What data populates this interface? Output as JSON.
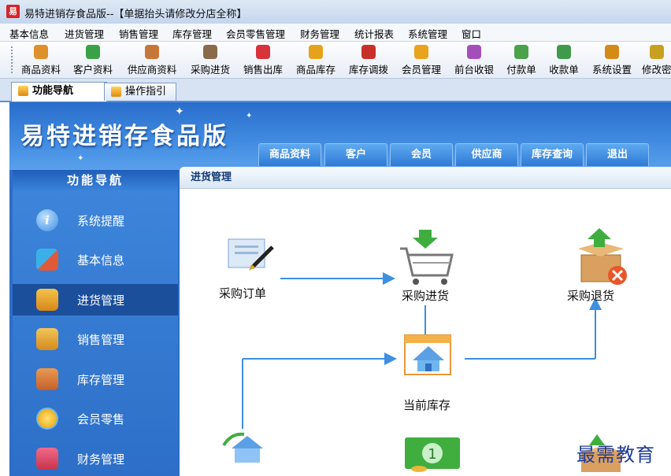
{
  "window": {
    "title": "易特进销存食品版--【单据抬头请修改分店全称】",
    "app_icon_text": "易"
  },
  "menu": [
    "基本信息",
    "进货管理",
    "销售管理",
    "库存管理",
    "会员零售管理",
    "财务管理",
    "统计报表",
    "系统管理",
    "窗口"
  ],
  "toolbar": [
    {
      "label": "商品资料",
      "icon": "goods-icon",
      "color": "#e0902a"
    },
    {
      "label": "客户资料",
      "icon": "customer-icon",
      "color": "#3aa246"
    },
    {
      "label": "供应商资料",
      "icon": "supplier-icon",
      "color": "#c7763a"
    },
    {
      "label": "采购进货",
      "icon": "truck-icon",
      "color": "#8a6a4a"
    },
    {
      "label": "销售出库",
      "icon": "cart-icon",
      "color": "#d8323a"
    },
    {
      "label": "商品库存",
      "icon": "stock-icon",
      "color": "#e6a21a"
    },
    {
      "label": "库存调拨",
      "icon": "transfer-icon",
      "color": "#c8302a"
    },
    {
      "label": "会员管理",
      "icon": "member-icon",
      "color": "#e9a31c"
    },
    {
      "label": "前台收银",
      "icon": "cashier-icon",
      "color": "#a44fb8"
    },
    {
      "label": "付款单",
      "icon": "payment-icon",
      "color": "#4aa24a"
    },
    {
      "label": "收款单",
      "icon": "receipt-icon",
      "color": "#3f9a4a"
    },
    {
      "label": "系统设置",
      "icon": "settings-icon",
      "color": "#d48a18"
    },
    {
      "label": "修改密",
      "icon": "password-icon",
      "color": "#c8a020"
    }
  ],
  "tabs": [
    {
      "label": "功能导航"
    },
    {
      "label": "操作指引"
    }
  ],
  "banner": {
    "brand": "易特进销存食品版"
  },
  "top_nav": [
    "商品资料",
    "客户",
    "会员",
    "供应商",
    "库存查询",
    "退出"
  ],
  "left_nav": {
    "title": "功能导航",
    "items": [
      {
        "label": "系统提醒",
        "icon": "info-icon",
        "color": "#3d8fe0"
      },
      {
        "label": "基本信息",
        "icon": "blocks-icon",
        "color": "#e05a3a"
      },
      {
        "label": "进货管理",
        "icon": "purchase-icon",
        "color": "#e7a21e"
      },
      {
        "label": "销售管理",
        "icon": "sales-icon",
        "color": "#e6a12a"
      },
      {
        "label": "库存管理",
        "icon": "house-icon",
        "color": "#d87a2a"
      },
      {
        "label": "会员零售",
        "icon": "member-icon",
        "color": "#f0b21e"
      },
      {
        "label": "财务管理",
        "icon": "finance-icon",
        "color": "#d84a6a"
      }
    ],
    "active": "进货管理"
  },
  "content": {
    "section_title": "进货管理",
    "nodes": [
      {
        "label": "采购订单",
        "icon": "order-pen-icon"
      },
      {
        "label": "采购进货",
        "icon": "cart-down-icon"
      },
      {
        "label": "采购退货",
        "icon": "box-return-icon"
      },
      {
        "label": "当前库存",
        "icon": "stock-house-icon"
      }
    ]
  },
  "watermark": "最需教育"
}
